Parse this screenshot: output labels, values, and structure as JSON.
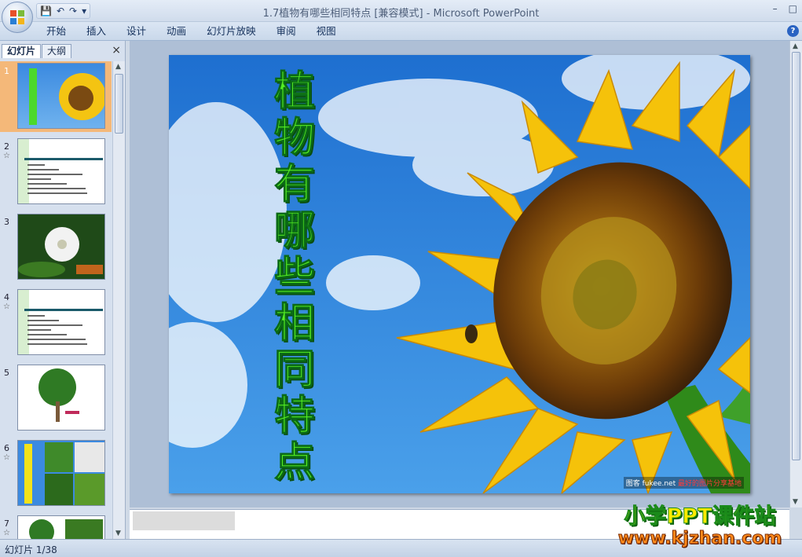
{
  "window": {
    "title": "1.7植物有哪些相同特点 [兼容模式] - Microsoft PowerPoint",
    "controls": [
      "–",
      "□"
    ]
  },
  "ribbon": {
    "tabs": [
      "开始",
      "插入",
      "设计",
      "动画",
      "幻灯片放映",
      "审阅",
      "视图"
    ]
  },
  "panel": {
    "tab_slides": "幻灯片",
    "tab_outline": "大纲",
    "close": "×",
    "thumbnails": [
      {
        "num": "1",
        "star": "",
        "selected": true
      },
      {
        "num": "2",
        "star": "☆",
        "selected": false
      },
      {
        "num": "3",
        "star": "",
        "selected": false
      },
      {
        "num": "4",
        "star": "☆",
        "selected": false
      },
      {
        "num": "5",
        "star": "",
        "selected": false
      },
      {
        "num": "6",
        "star": "☆",
        "selected": false
      },
      {
        "num": "7",
        "star": "☆",
        "selected": false
      }
    ]
  },
  "slide": {
    "title": "植物有哪些相同特点",
    "credit_site": "图客 fukee.net",
    "credit_text": "最好的图片分享基地"
  },
  "watermark": {
    "line1": "小学PPT课件站",
    "line2": "www.kjzhan.com"
  },
  "status": {
    "slide_counter": "幻灯片 1/38"
  },
  "colors": {
    "title_green": "#55ee22",
    "selected_thumb": "#f4b879",
    "sky": "#2f7fd8",
    "petal": "#f5c20a"
  }
}
